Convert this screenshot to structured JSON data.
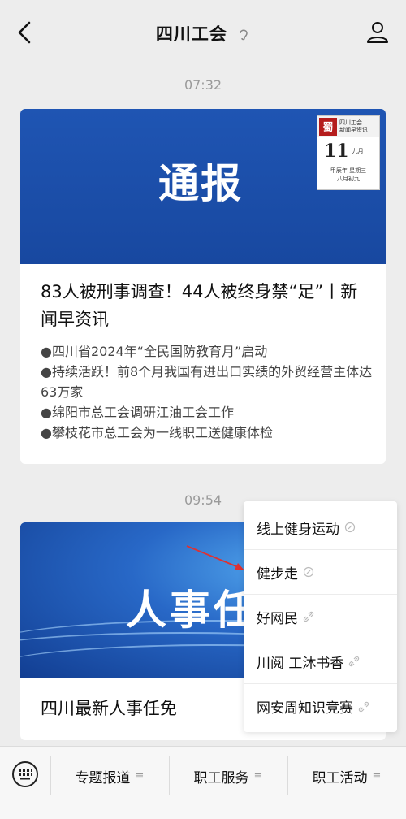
{
  "header": {
    "title": "四川工会",
    "back_icon": "chevron-left-icon",
    "profile_icon": "person-icon"
  },
  "messages": [
    {
      "time": "07:32",
      "banner_text": "通报",
      "brand": {
        "logo_char": "蜀",
        "name_line1": "四川工会",
        "name_line2": "新闻早资讯",
        "day": "11",
        "month": "九月",
        "lunar_line1": "甲辰年",
        "lunar_line2": "八月初九",
        "weekday": "星期三"
      },
      "title": "83人被刑事调查！44人被终身禁“足”丨新闻早资讯",
      "bullets": [
        "●四川省2024年“全民国防教育月”启动",
        "●持续活跃！前8个月我国有进出口实绩的外贸经营主体达63万家",
        "●绵阳市总工会调研江油工会工作",
        "●攀枝花市总工会为一线职工送健康体检"
      ]
    },
    {
      "time": "09:54",
      "banner_text": "人事任",
      "title": "四川最新人事任免"
    }
  ],
  "popup_menu": {
    "items": [
      {
        "label": "线上健身运动"
      },
      {
        "label": "健步走"
      },
      {
        "label": "好网民"
      },
      {
        "label": "川阅 工沐书香"
      },
      {
        "label": "网安周知识竞赛"
      }
    ]
  },
  "bottom_bar": {
    "keyboard_icon": "keyboard-icon",
    "tabs": [
      {
        "label": "专题报道"
      },
      {
        "label": "职工服务"
      },
      {
        "label": "职工活动"
      }
    ]
  },
  "colors": {
    "background": "#ededed",
    "banner_blue": "#1f55b3",
    "annotation_arrow": "#e03131"
  }
}
